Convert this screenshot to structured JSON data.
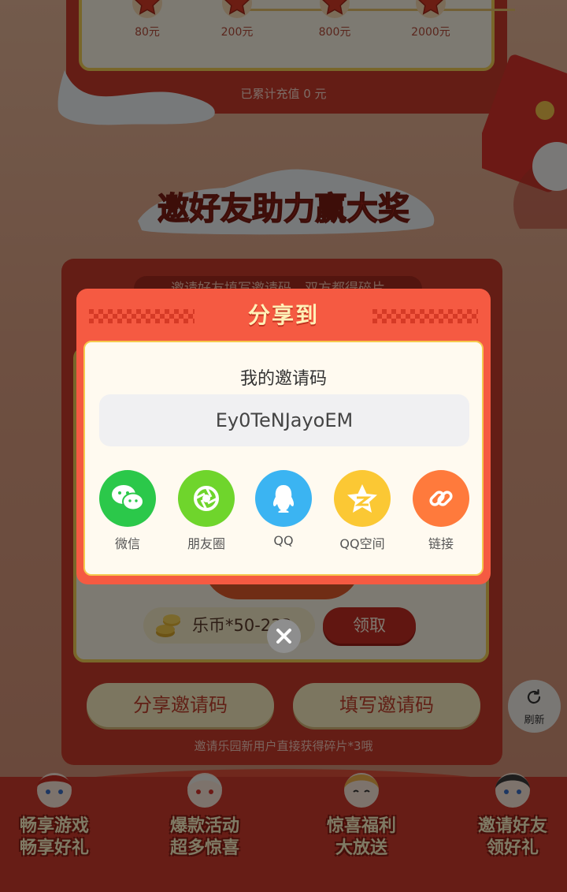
{
  "recharge": {
    "milestones": [
      {
        "label": "80元"
      },
      {
        "label": "200元"
      },
      {
        "label": "800元"
      },
      {
        "label": "2000元"
      }
    ],
    "total_text": "已累计充值 0 元"
  },
  "invite": {
    "title": "邀好友助力赢大奖",
    "subtitle": "邀请好友填写邀请码，双方都得碎片",
    "coin_text": "乐币*50-233",
    "claim_label": "领取",
    "share_code_label": "分享邀请码",
    "fill_code_label": "填写邀请码",
    "footnote": "邀请乐园新用户直接获得碎片*3哦"
  },
  "refresh": {
    "label": "刷新"
  },
  "bottom_nav": [
    {
      "label": "畅享游戏\n畅享好礼"
    },
    {
      "label": "爆款活动\n超多惊喜"
    },
    {
      "label": "惊喜福利\n大放送"
    },
    {
      "label": "邀请好友\n领好礼"
    }
  ],
  "share_modal": {
    "title": "分享到",
    "code_label": "我的邀请码",
    "code_value": "Ey0TeNJayoEM",
    "options": [
      {
        "label": "微信",
        "icon": "wechat-icon",
        "color": "#2bc84a"
      },
      {
        "label": "朋友圈",
        "icon": "moments-icon",
        "color": "#6fd52c"
      },
      {
        "label": "QQ",
        "icon": "qq-icon",
        "color": "#3bb4f2"
      },
      {
        "label": "QQ空间",
        "icon": "qzone-icon",
        "color": "#fbc834"
      },
      {
        "label": "链接",
        "icon": "link-icon",
        "color": "#ff7a3c"
      }
    ]
  },
  "colors": {
    "brand_red": "#c93a2a",
    "modal_red": "#f55a42",
    "cream": "#fbf4e4",
    "gold": "#f3cf55"
  }
}
